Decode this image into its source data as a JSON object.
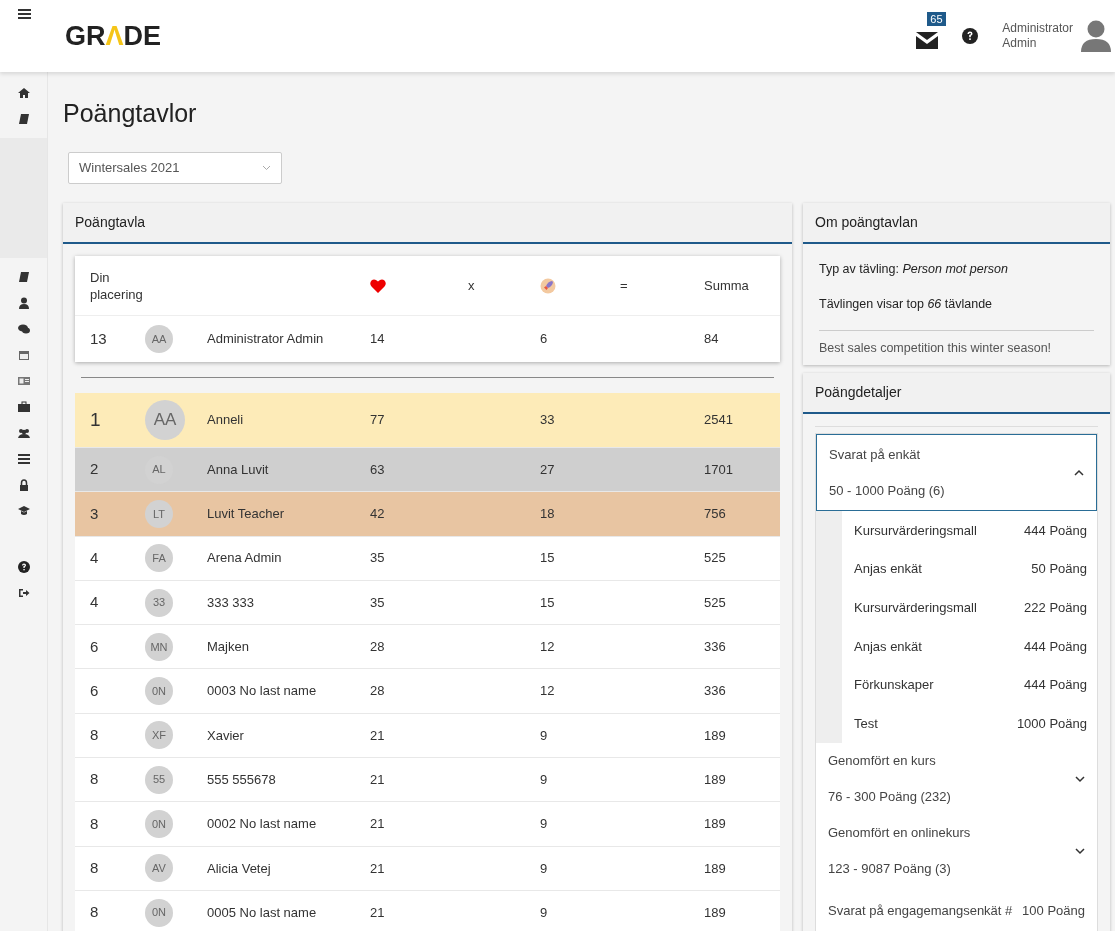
{
  "nav": {
    "logo": [
      {
        "text": "GR"
      },
      {
        "text": "Λ",
        "accent": true
      },
      {
        "text": "DE"
      }
    ],
    "mail_count": "65",
    "user": [
      "Administrator",
      "Admin"
    ]
  },
  "page_title": "Poängtavlor",
  "competition_select": {
    "value": "Wintersales 2021"
  },
  "scoreboard": {
    "title": "Poängtavla",
    "header": {
      "rank": "Din placering",
      "times": "x",
      "equals": "=",
      "sum": "Summa"
    },
    "me": {
      "rank": "13",
      "initials": "AA",
      "name": "Administrator Admin",
      "hearts": "14",
      "rockets": "6",
      "sum": "84"
    },
    "rows": [
      {
        "rank": "1",
        "initials": "AA",
        "name": "Anneli",
        "hearts": "77",
        "rockets": "33",
        "sum": "2541",
        "color": "#fdebb8",
        "leader": true
      },
      {
        "rank": "2",
        "initials": "AL",
        "name": "Anna Luvit",
        "hearts": "63",
        "rockets": "27",
        "sum": "1701",
        "color": "#cfcfcf",
        "leader": false
      },
      {
        "rank": "3",
        "initials": "LT",
        "name": "Luvit Teacher",
        "hearts": "42",
        "rockets": "18",
        "sum": "756",
        "color": "#e8c5a2",
        "leader": false
      },
      {
        "rank": "4",
        "initials": "FA",
        "name": "Arena Admin",
        "hearts": "35",
        "rockets": "15",
        "sum": "525",
        "leader": false
      },
      {
        "rank": "4",
        "initials": "33",
        "name": "333 333",
        "hearts": "35",
        "rockets": "15",
        "sum": "525",
        "leader": false
      },
      {
        "rank": "6",
        "initials": "MN",
        "name": "Majken",
        "hearts": "28",
        "rockets": "12",
        "sum": "336",
        "leader": false
      },
      {
        "rank": "6",
        "initials": "0N",
        "name": "0003 No last name",
        "hearts": "28",
        "rockets": "12",
        "sum": "336",
        "leader": false
      },
      {
        "rank": "8",
        "initials": "XF",
        "name": "Xavier",
        "hearts": "21",
        "rockets": "9",
        "sum": "189",
        "leader": false
      },
      {
        "rank": "8",
        "initials": "55",
        "name": "555 555678",
        "hearts": "21",
        "rockets": "9",
        "sum": "189",
        "leader": false
      },
      {
        "rank": "8",
        "initials": "0N",
        "name": "0002 No last name",
        "hearts": "21",
        "rockets": "9",
        "sum": "189",
        "leader": false
      },
      {
        "rank": "8",
        "initials": "AV",
        "name": "Alicia Vetej",
        "hearts": "21",
        "rockets": "9",
        "sum": "189",
        "leader": false
      },
      {
        "rank": "8",
        "initials": "0N",
        "name": "0005 No last name",
        "hearts": "21",
        "rockets": "9",
        "sum": "189",
        "leader": false
      }
    ]
  },
  "about": {
    "title": "Om poängtavlan",
    "facts": [
      "Typ av tävling: *Person mot person*",
      "Tävlingen visar top *66* tävlande"
    ],
    "description": "Best sales competition this winter season!"
  },
  "details": {
    "title": "Poängdetaljer",
    "groups": [
      {
        "title": "Svarat på enkät",
        "range": "50 - 1000 Poäng (6)",
        "expanded": true,
        "items": [
          {
            "name": "Kursurvärderingsmall",
            "points": "444 Poäng"
          },
          {
            "name": "Anjas enkät",
            "points": "50 Poäng"
          },
          {
            "name": "Kursurvärderingsmall",
            "points": "222 Poäng"
          },
          {
            "name": "Anjas enkät",
            "points": "444 Poäng"
          },
          {
            "name": "Förkunskaper",
            "points": "444 Poäng"
          },
          {
            "name": "Test",
            "points": "1000 Poäng"
          }
        ]
      },
      {
        "title": "Genomfört en kurs",
        "range": "76 - 300 Poäng (232)",
        "expanded": false
      },
      {
        "title": "Genomfört en onlinekurs",
        "range": "123 - 9087 Poäng (3)",
        "expanded": false
      },
      {
        "title": "Svarat på engagemangsenkät #",
        "points": "100 Poäng"
      }
    ]
  }
}
